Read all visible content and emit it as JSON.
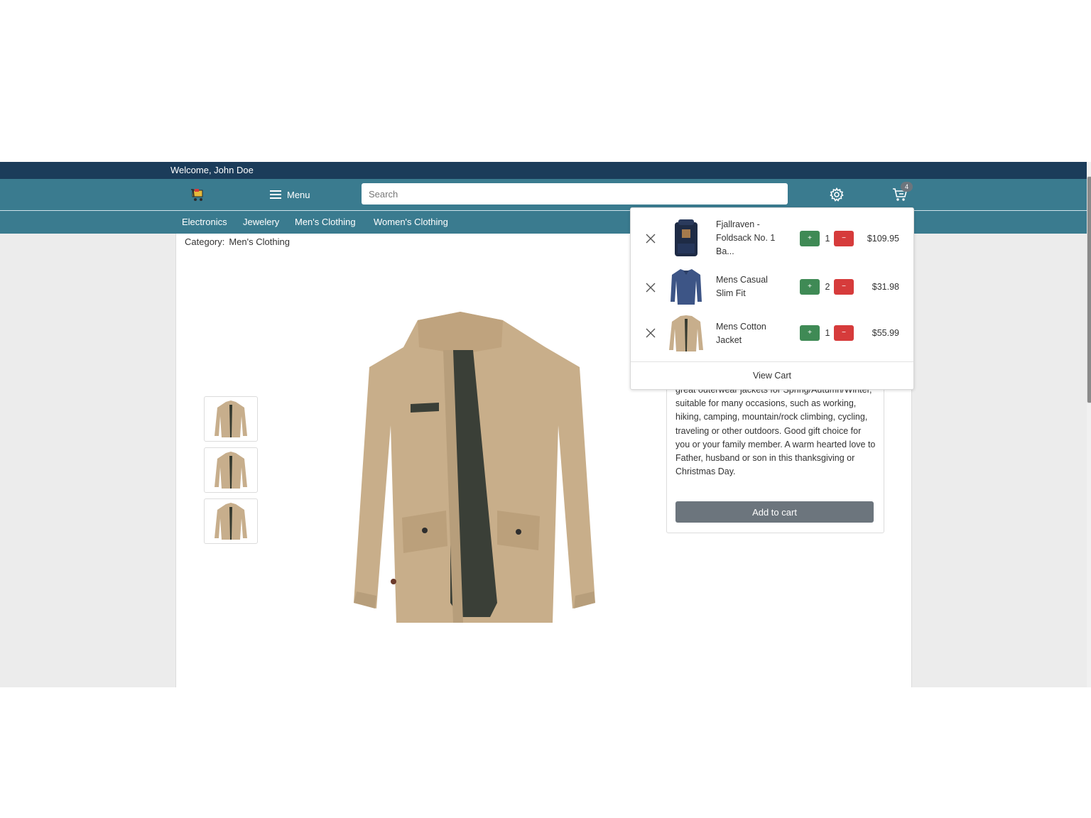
{
  "header": {
    "welcome": "Welcome, John Doe",
    "menu_label": "Menu",
    "search_placeholder": "Search",
    "cart_count": "4"
  },
  "categories": [
    "Electronics",
    "Jewelery",
    "Men's Clothing",
    "Women's Clothing"
  ],
  "breadcrumb": {
    "label": "Category:",
    "value": "Men's Clothing"
  },
  "product": {
    "description": "great outerwear jackets for Spring/Autumn/Winter, suitable for many occasions, such as working, hiking, camping, mountain/rock climbing, cycling, traveling or other outdoors. Good gift choice for you or your family member. A warm hearted love to Father, husband or son in this thanksgiving or Christmas Day.",
    "add_to_cart": "Add to cart"
  },
  "cart": {
    "items": [
      {
        "name": "Fjallraven - Foldsack No. 1 Ba...",
        "qty": "1",
        "price": "$109.95",
        "plus": "+",
        "minus": "−"
      },
      {
        "name": "Mens Casual Slim Fit",
        "qty": "2",
        "price": "$31.98",
        "plus": "+",
        "minus": "−"
      },
      {
        "name": "Mens Cotton Jacket",
        "qty": "1",
        "price": "$55.99",
        "plus": "+",
        "minus": "−"
      }
    ],
    "view_cart": "View Cart"
  },
  "colors": {
    "top_bar": "#1b3c5a",
    "nav": "#3a7b8f",
    "plus_button": "#3f8a55",
    "minus_button": "#d63b3b",
    "add_to_cart_button": "#6c757d"
  },
  "icons": [
    "shop-logo-icon",
    "menu-icon",
    "gear-icon",
    "cart-icon",
    "close-icon"
  ]
}
